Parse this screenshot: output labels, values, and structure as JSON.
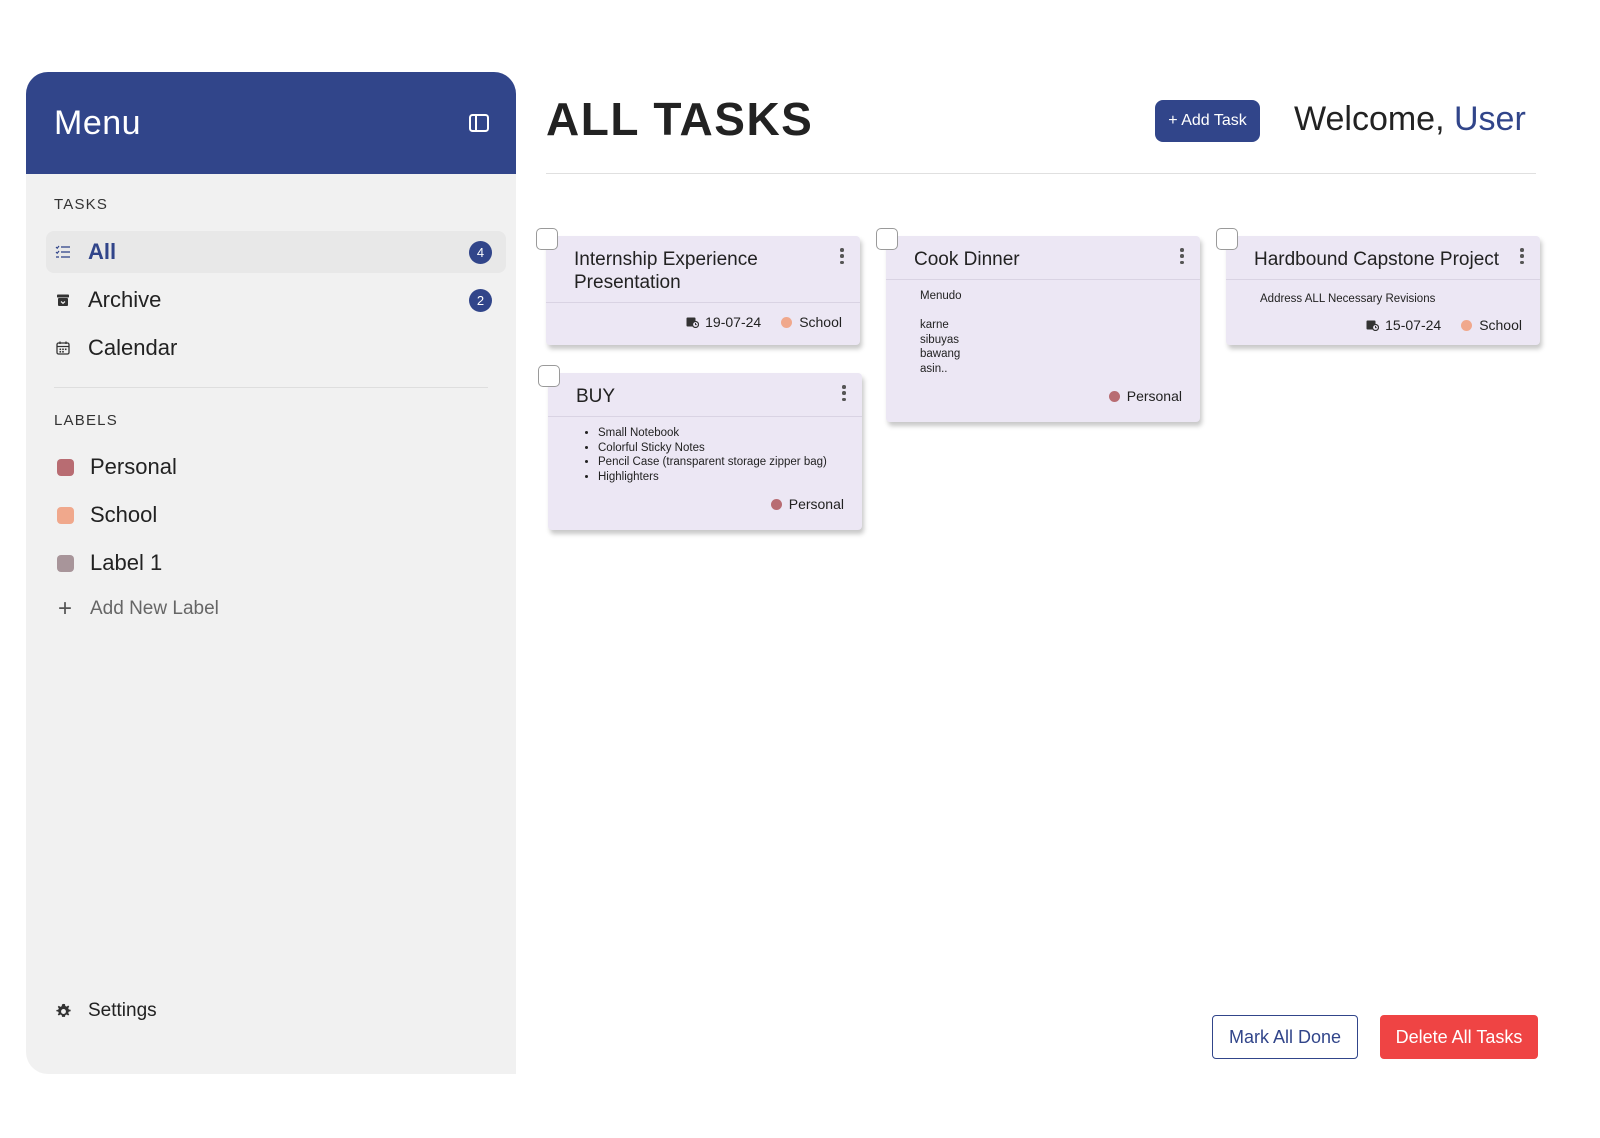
{
  "colors": {
    "primary": "#31458a",
    "danger": "#ef4444",
    "card_bg": "#ece7f4",
    "personal": "#b86c72",
    "school": "#f0a88c",
    "label1": "#a8959a"
  },
  "sidebar": {
    "title": "Menu",
    "toggle_icon": "sidebar-panel-icon",
    "tasks_heading": "TASKS",
    "tasks": [
      {
        "label": "All",
        "icon": "list-check-icon",
        "count": "4",
        "active": true
      },
      {
        "label": "Archive",
        "icon": "archive-icon",
        "count": "2"
      },
      {
        "label": "Calendar",
        "icon": "calendar-icon"
      }
    ],
    "labels_heading": "LABELS",
    "labels": [
      {
        "label": "Personal",
        "color": "#b86c72"
      },
      {
        "label": "School",
        "color": "#f0a88c"
      },
      {
        "label": "Label 1",
        "color": "#a8959a"
      }
    ],
    "add_label": "Add New Label",
    "settings": "Settings"
  },
  "header": {
    "title": "ALL TASKS",
    "add_task": "+ Add Task",
    "welcome": "Welcome, ",
    "user": "User"
  },
  "cards": [
    {
      "title": "Internship Experience\nPresentation",
      "date": "19-07-24",
      "tag": "School"
    },
    {
      "title": "Cook Dinner",
      "body": "Menudo\n\nkarne\nsibuyas\nbawang\nasin..",
      "tag": "Personal"
    },
    {
      "title": "Hardbound Capstone Project",
      "body": "Address ALL Necessary Revisions",
      "date": "15-07-24",
      "tag": "School"
    },
    {
      "title": "BUY",
      "items": [
        "Small Notebook",
        "Colorful Sticky Notes",
        "Pencil Case (transparent storage zipper bag)",
        "Highlighters"
      ],
      "tag": "Personal"
    }
  ],
  "footer": {
    "mark_all_done": "Mark All Done",
    "delete_all": "Delete All Tasks"
  }
}
